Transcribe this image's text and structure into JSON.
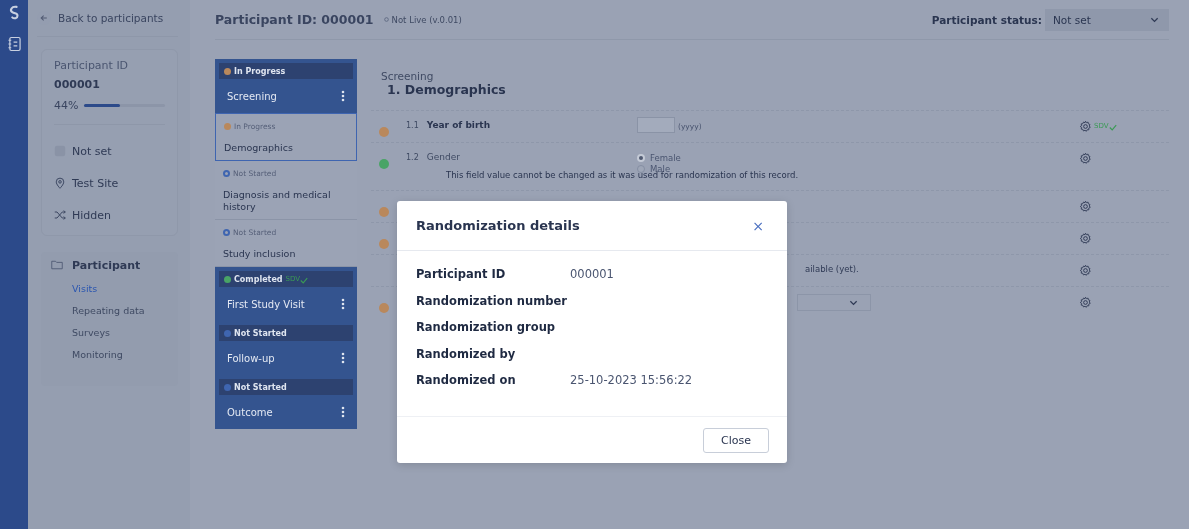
{
  "sidebar": {
    "back_link": "Back to participants",
    "participant": {
      "label": "Participant ID",
      "id": "000001",
      "progress": "44%",
      "level": 0.44
    },
    "details": [
      {
        "kind": "status",
        "label": "Not set"
      },
      {
        "kind": "site",
        "label": "Test Site"
      },
      {
        "kind": "arm",
        "label": "Hidden"
      }
    ],
    "nav": {
      "title": "Participant",
      "items": [
        {
          "label": "Visits",
          "selected": true
        },
        {
          "label": "Repeating data",
          "selected": false
        },
        {
          "label": "Surveys",
          "selected": false
        },
        {
          "label": "Monitoring",
          "selected": false
        }
      ]
    }
  },
  "header": {
    "title": "Participant ID: 000001",
    "badge": "Not Live (v.0.01)",
    "status_label": "Participant status:",
    "status_value": "Not set"
  },
  "phases": [
    {
      "status": "In Progress",
      "color": "#b9885c",
      "name": "Screening",
      "forms": [
        {
          "status": "In Progress",
          "color": "#b9885c",
          "filled": true,
          "name": "Demographics",
          "selected": true
        },
        {
          "status": "Not Started",
          "color": "#3f65b0",
          "filled": false,
          "name": "Diagnosis and medical history",
          "selected": false
        },
        {
          "status": "Not Started",
          "color": "#3f65b0",
          "filled": false,
          "name": "Study inclusion",
          "selected": false
        }
      ]
    },
    {
      "status": "Completed",
      "color": "#49a466",
      "name": "First Study Visit",
      "sdv": "SDV"
    },
    {
      "status": "Not Started",
      "color": "#3f65b0",
      "name": "Follow-up"
    },
    {
      "status": "Not Started",
      "color": "#3f65b0",
      "name": "Outcome"
    }
  ],
  "form": {
    "section": "Screening",
    "title": "1. Demographics",
    "rows": [
      {
        "kind": "year",
        "color": "#b9885c",
        "number": "1.1",
        "label": "Year of birth",
        "hint": "(yyyy)",
        "sdv": "SDV"
      },
      {
        "kind": "radio",
        "color": "#49a466",
        "number": "1.2",
        "label": "Gender",
        "options": [
          {
            "label": "Female",
            "selected": true
          },
          {
            "label": "Male",
            "selected": false
          }
        ],
        "note": "This field value cannot be changed as it was used for randomization of this record."
      },
      {
        "kind": "covered",
        "color": "#b9885c"
      },
      {
        "kind": "covered",
        "color": "#b9885c"
      },
      {
        "kind": "text",
        "text": "ailable (yet)."
      },
      {
        "kind": "select",
        "color": "#b9885c"
      }
    ]
  },
  "modal": {
    "title": "Randomization details",
    "close_symbol": "×",
    "fields": [
      {
        "label": "Participant ID",
        "value": "000001"
      },
      {
        "label": "Randomization number"
      },
      {
        "label": "Randomization group"
      },
      {
        "label": "Randomized by"
      },
      {
        "label": "Randomized on",
        "value": "25-10-2023 15:56:22"
      }
    ],
    "button": "Close"
  }
}
